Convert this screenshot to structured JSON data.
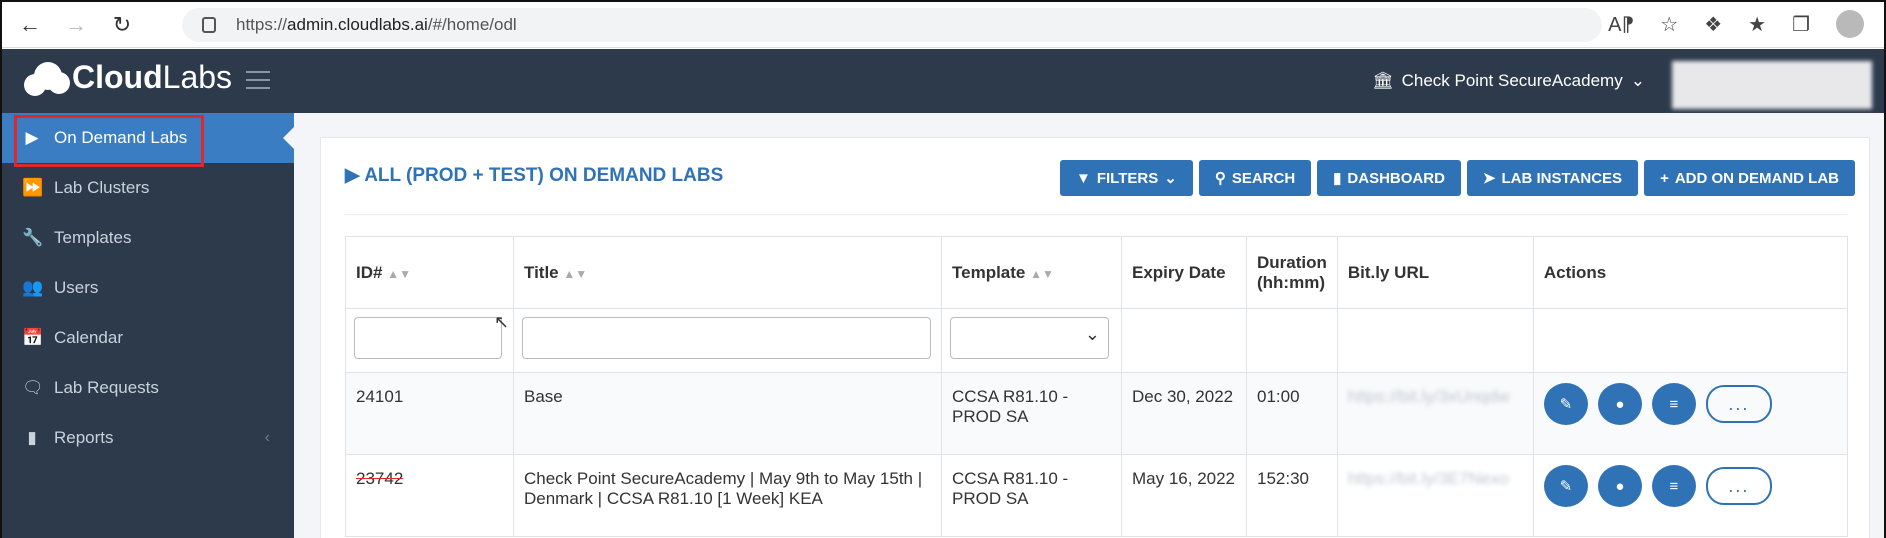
{
  "browser": {
    "url_prefix": "https://",
    "url_host": "admin.cloudlabs.ai",
    "url_path": "/#/home/odl"
  },
  "brand": {
    "logo_a": "Cloud",
    "logo_b": "Labs"
  },
  "topbar": {
    "org": "Check Point SecureAcademy"
  },
  "sidebar": {
    "items": [
      {
        "label": "On Demand Labs",
        "icon": "play-icon"
      },
      {
        "label": "Lab Clusters",
        "icon": "fast-forward-icon"
      },
      {
        "label": "Templates",
        "icon": "wrench-icon"
      },
      {
        "label": "Users",
        "icon": "users-icon"
      },
      {
        "label": "Calendar",
        "icon": "calendar-icon"
      },
      {
        "label": "Lab Requests",
        "icon": "chat-icon"
      },
      {
        "label": "Reports",
        "icon": "bar-chart-icon"
      }
    ]
  },
  "main": {
    "title": "ALL (PROD + TEST) ON DEMAND LABS",
    "buttons": {
      "filters": "FILTERS",
      "search": "SEARCH",
      "dashboard": "DASHBOARD",
      "lab_instances": "LAB INSTANCES",
      "add": "ADD ON DEMAND LAB"
    },
    "columns": {
      "id": "ID#",
      "title": "Title",
      "template": "Template",
      "expiry": "Expiry Date",
      "duration_a": "Duration",
      "duration_b": "(hh:mm)",
      "bitly": "Bit.ly URL",
      "actions": "Actions"
    },
    "rows": [
      {
        "id": "24101",
        "title": "Base",
        "template_a": "CCSA R81.10 -",
        "template_b": "PROD SA",
        "expiry": "Dec 30, 2022",
        "duration": "01:00",
        "bitly": "https://bit.ly/3xUnqdw"
      },
      {
        "id": "23742",
        "title_a": "Check Point SecureAcademy | May 9th to May 15th |",
        "title_b": "Denmark | CCSA R81.10 [1 Week] KEA",
        "template_a": "CCSA R81.10 -",
        "template_b": "PROD SA",
        "expiry": "May 16, 2022",
        "duration": "152:30",
        "bitly": "https://bit.ly/3E7Nexo"
      }
    ],
    "more_label": "..."
  }
}
